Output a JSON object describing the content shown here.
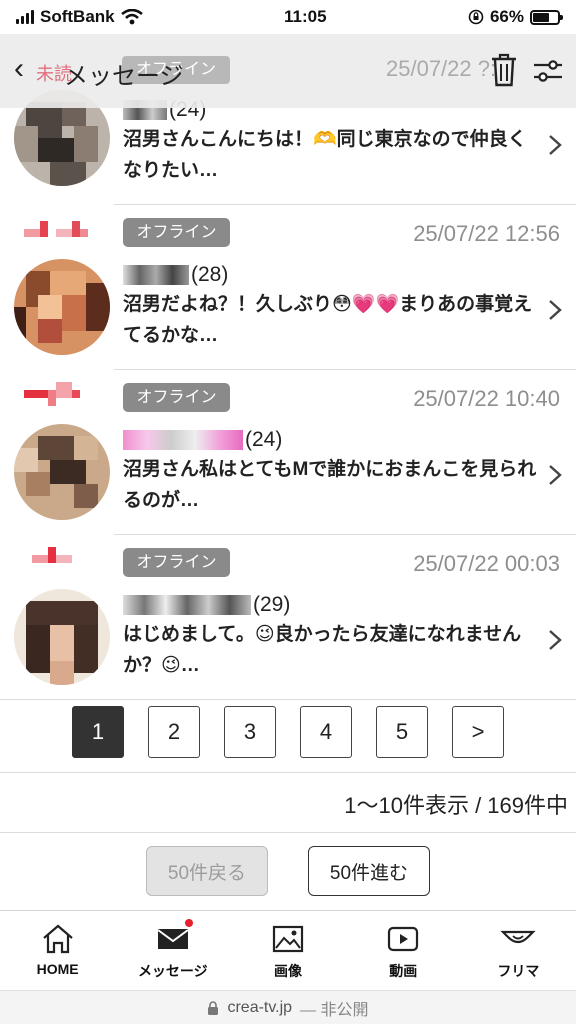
{
  "status_bar": {
    "carrier": "SoftBank",
    "time": "11:05",
    "battery": "66%",
    "battery_level": 0.66
  },
  "header": {
    "title": "メッセージ",
    "badge": "未読",
    "back_glyph": "‹",
    "faded_status": "オフライン",
    "faded_date": "25/07/22 ?:"
  },
  "messages": [
    {
      "name_suffix": "(24)",
      "status": "",
      "date": "",
      "preview": "沼男さんこんにちは！🫶同じ東京なので仲良くなりたい…"
    },
    {
      "name_suffix": "(28)",
      "status": "オフライン",
      "date": "25/07/22 12:56",
      "preview": "沼男だよね？！久しぶり😳💗💗まりあの事覚えてるかな…"
    },
    {
      "name_suffix": "(24)",
      "status": "オフライン",
      "date": "25/07/22 10:40",
      "preview": "沼男さん私はとてもMで誰かにおまんこを見られるのが…"
    },
    {
      "name_suffix": "(29)",
      "status": "オフライン",
      "date": "25/07/22 00:03",
      "preview": "はじめまして。😉良かったら友達になれませんか？😉…"
    }
  ],
  "pagination": {
    "pages": [
      "1",
      "2",
      "3",
      "4",
      "5"
    ],
    "next": ">",
    "current": "1"
  },
  "result_count": "1〜10件表示 / 169件中",
  "buttons": {
    "back50": "50件戻る",
    "forward50": "50件進む"
  },
  "nav": [
    {
      "label": "HOME",
      "icon": "home-icon"
    },
    {
      "label": "メッセージ",
      "icon": "mail-icon"
    },
    {
      "label": "画像",
      "icon": "image-icon"
    },
    {
      "label": "動画",
      "icon": "video-icon"
    },
    {
      "label": "フリマ",
      "icon": "market-icon"
    }
  ],
  "url_bar": {
    "domain": "crea-tv.jp",
    "suffix": "— 非公開"
  },
  "colors": {
    "status_pill": "#8a8a8a",
    "active_page": "#333333",
    "notification": "#e5202d"
  }
}
